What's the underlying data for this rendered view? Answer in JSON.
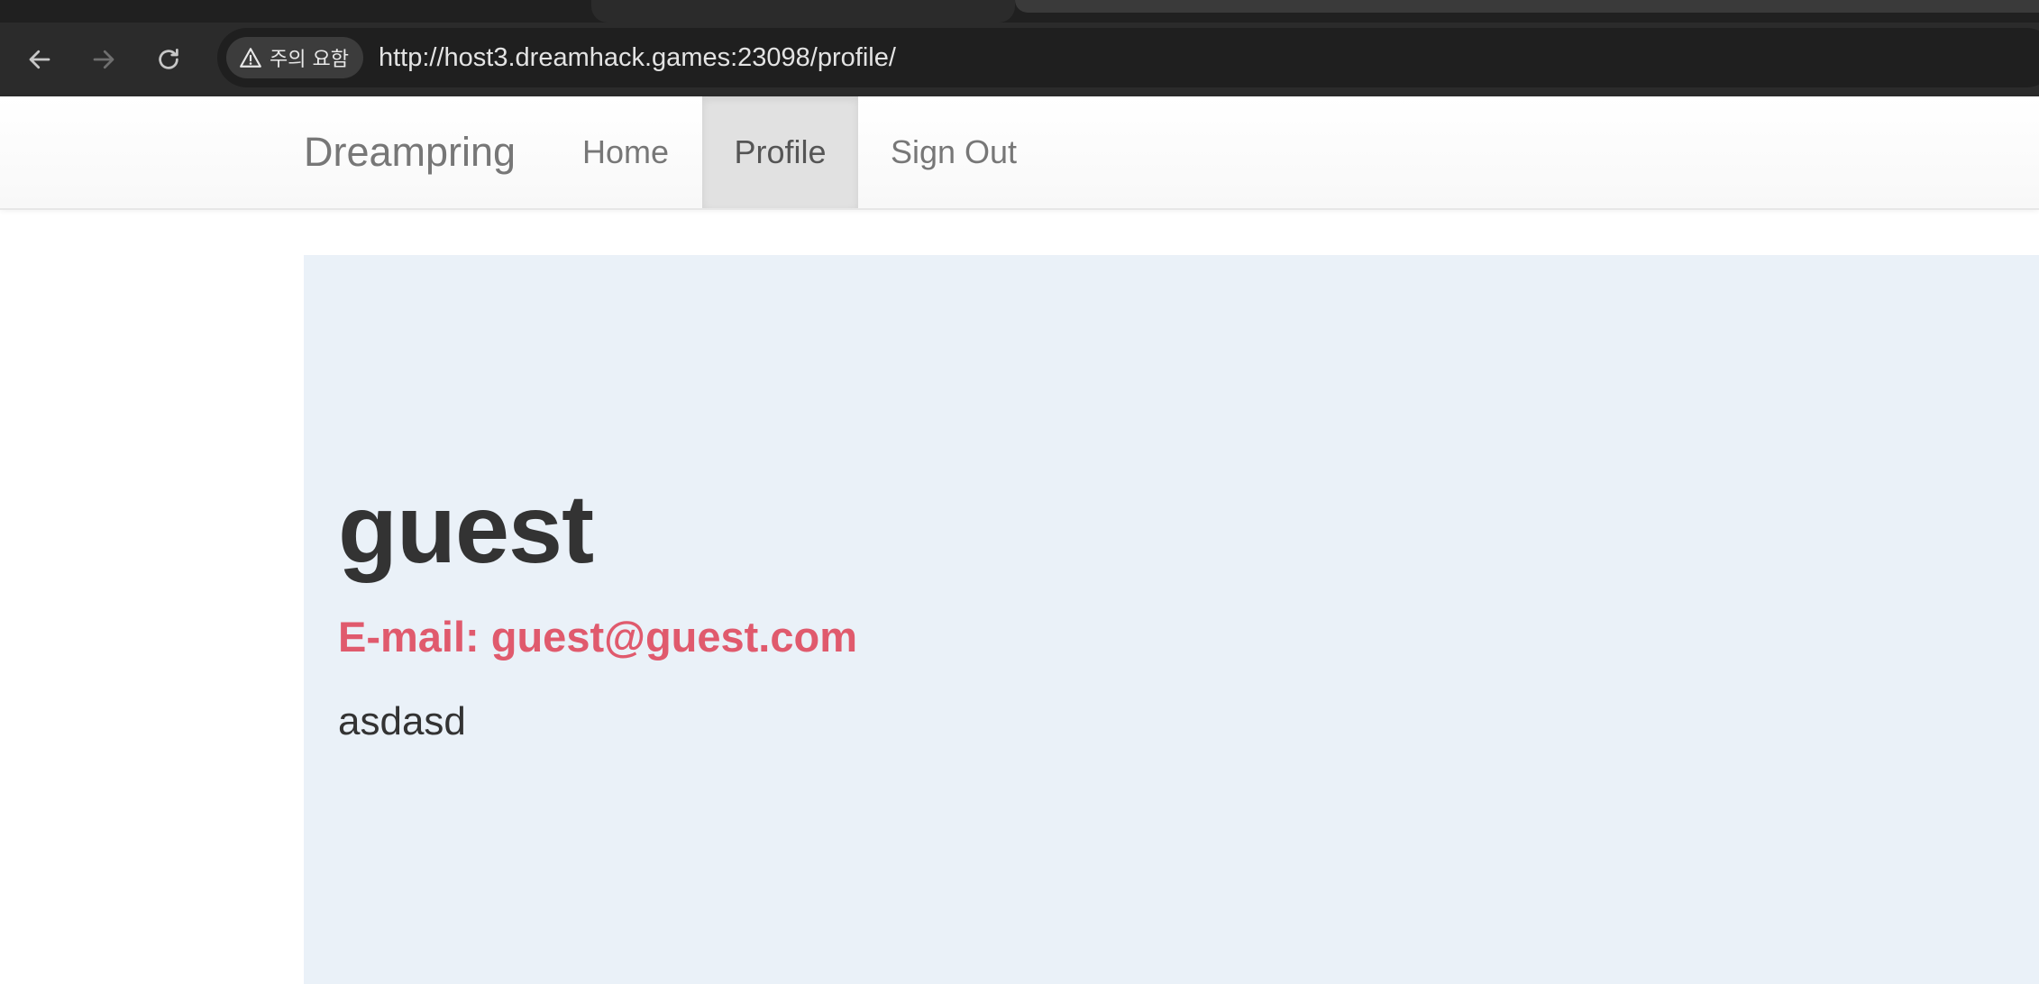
{
  "browser": {
    "security_chip_label": "주의 요함",
    "url": "http://host3.dreamhack.games:23098/profile/"
  },
  "navbar": {
    "brand": "Dreampring",
    "items": [
      {
        "label": "Home",
        "active": false
      },
      {
        "label": "Profile",
        "active": true
      },
      {
        "label": "Sign Out",
        "active": false
      }
    ]
  },
  "profile": {
    "username": "guest",
    "email_label": "E-mail:",
    "email_value": "guest@guest.com",
    "bio": "asdasd"
  },
  "colors": {
    "email_accent": "#e05a6d",
    "jumbotron_bg": "#eaf1f8",
    "chrome_bg": "#2b2b2b"
  }
}
